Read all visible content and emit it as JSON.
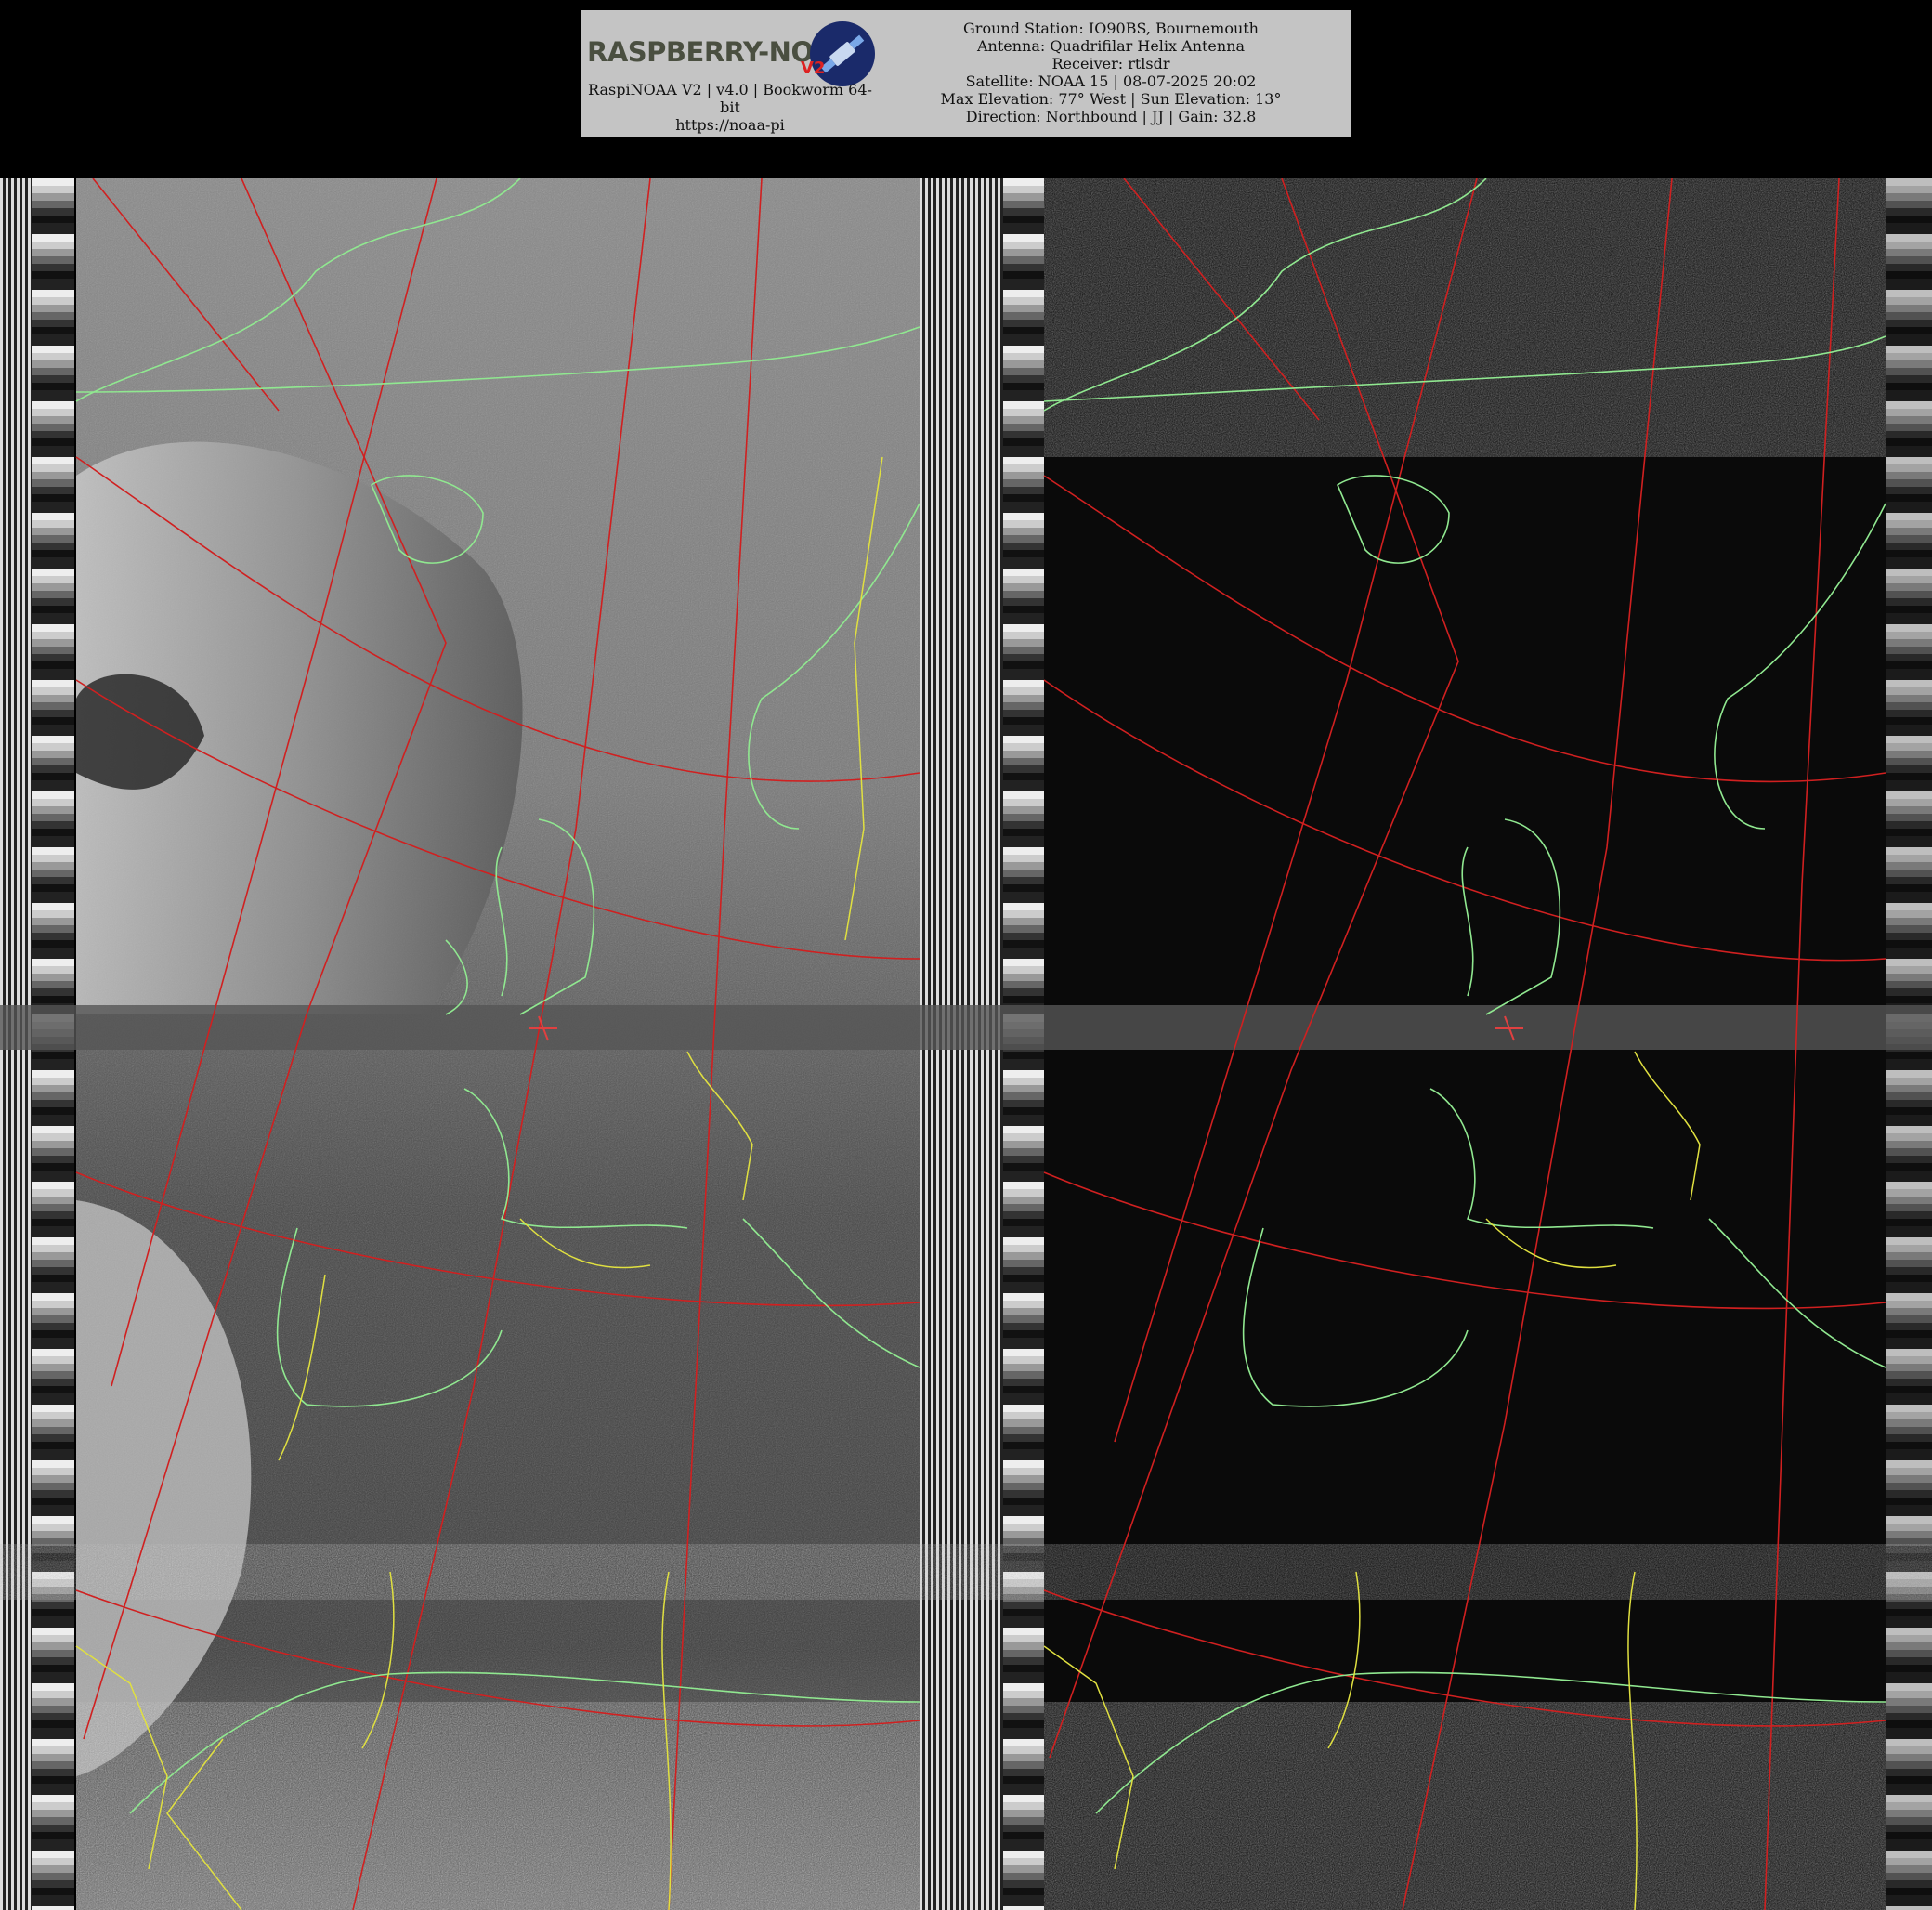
{
  "header": {
    "logo_text": "RASPBERRY-NOAA",
    "logo_suffix": "V2",
    "software_line": "RaspiNOAA V2 | v4.0 | Bookworm 64-bit",
    "url": "https://noaa-pi",
    "ground_station": "Ground Station: IO90BS, Bournemouth",
    "antenna": "Antenna: Quadrifilar Helix Antenna",
    "receiver": "Receiver: rtlsdr",
    "satellite": "Satellite: NOAA 15 | 08-07-2025 20:02",
    "elevation": "Max Elevation: 77° West | Sun Elevation: 13°",
    "direction": "Direction: Northbound | JJ | Gain: 32.8"
  },
  "colors": {
    "background": "#000000",
    "header_bg": "#c4c4c4",
    "grid_lines": "#d02020",
    "coastlines": "#90e890",
    "borders": "#e0e040"
  },
  "imagery": {
    "channels": [
      "visible-channel-a",
      "infrared-channel-b"
    ]
  }
}
